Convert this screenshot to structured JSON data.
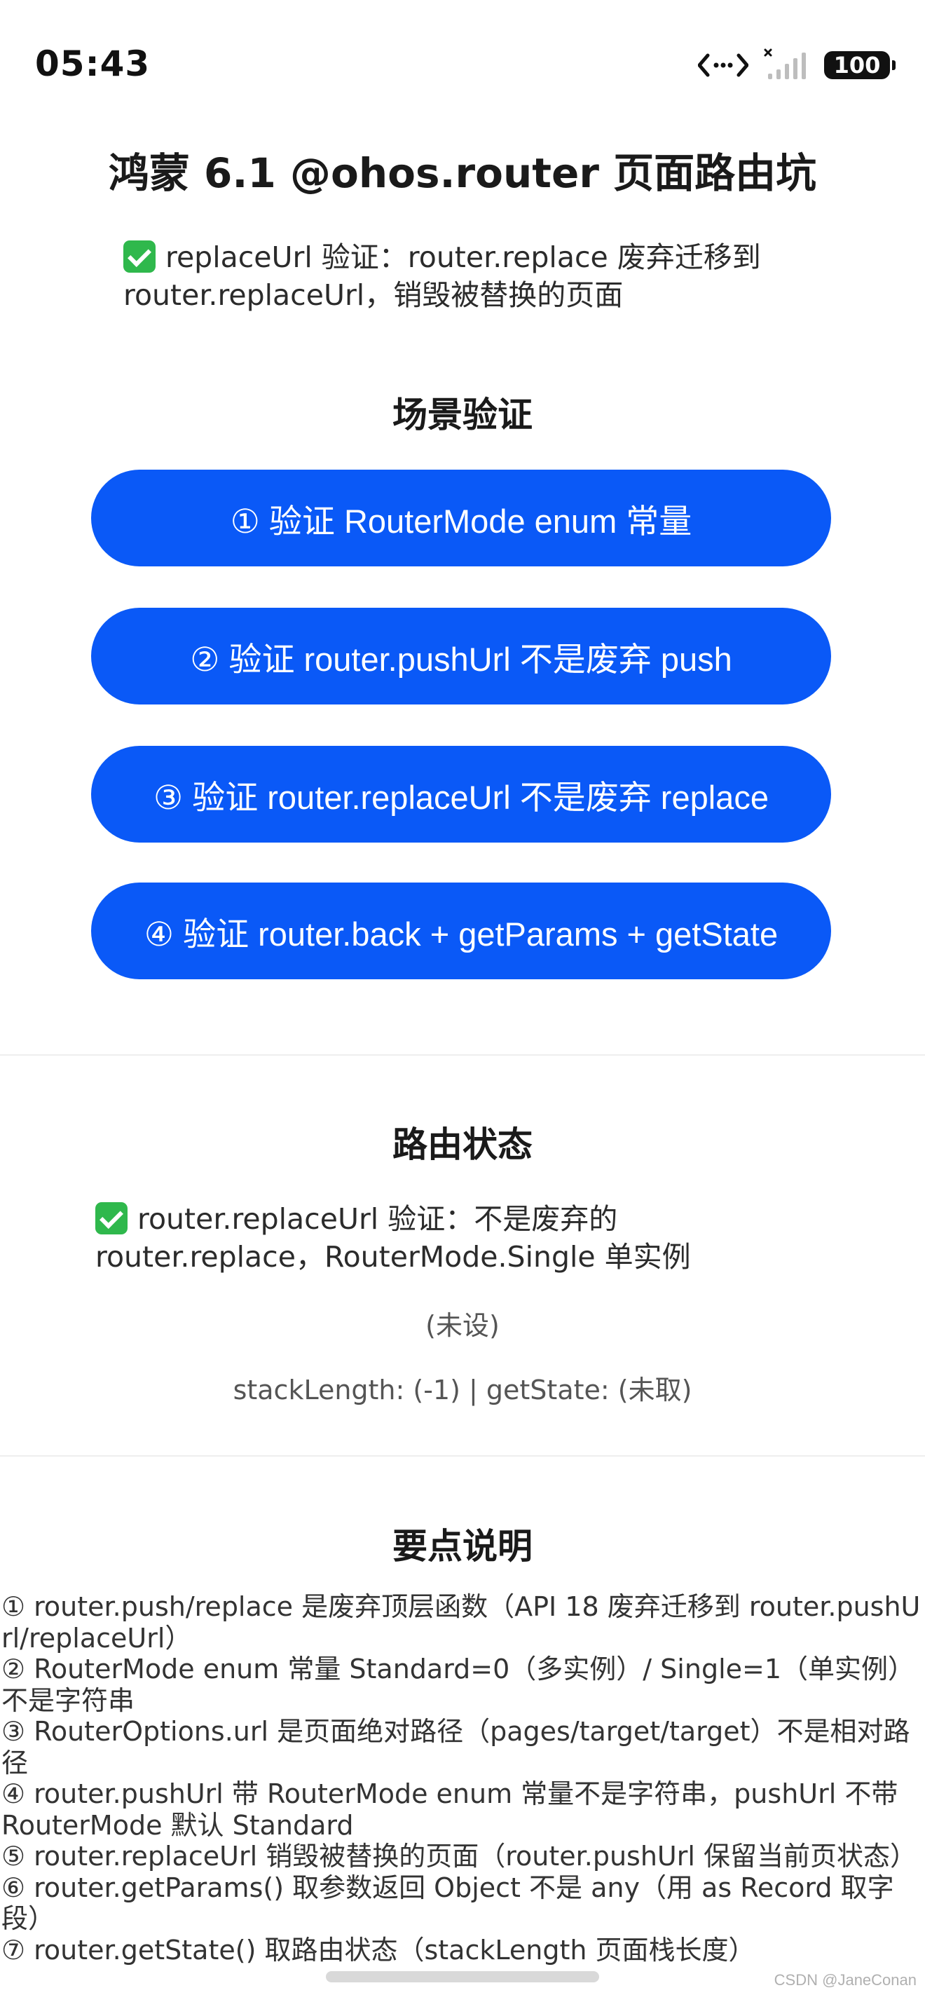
{
  "status_bar": {
    "time": "05:43",
    "battery": "100",
    "icons": [
      "dots-exchange-icon",
      "signal-icon",
      "battery-icon"
    ]
  },
  "page": {
    "title": "鸿蒙 6.1 @ohos.router 页面路由坑",
    "top_status": "replaceUrl 验证：router.replace 废弃迁移到 router.replaceUrl，销毁被替换的页面"
  },
  "scenarios": {
    "title": "场景验证",
    "buttons": [
      "① 验证 RouterMode enum 常量",
      "② 验证 router.pushUrl 不是废弃 push",
      "③ 验证 router.replaceUrl 不是废弃 replace",
      "④ 验证 router.back + getParams + getState"
    ]
  },
  "route_state": {
    "title": "路由状态",
    "status": "router.replaceUrl 验证：不是废弃的 router.replace，RouterMode.Single 单实例",
    "params": "(未设)",
    "stack": "stackLength: (-1) | getState: (未取)"
  },
  "notes": {
    "title": "要点说明",
    "items": [
      "① router.push/replace 是废弃顶层函数（API 18 废弃迁移到 router.pushUrl/replaceUrl）",
      "② RouterMode enum 常量 Standard=0（多实例）/ Single=1（单实例）不是字符串",
      "③ RouterOptions.url 是页面绝对路径（pages/target/target）不是相对路径",
      "④ router.pushUrl 带 RouterMode enum 常量不是字符串，pushUrl 不带 RouterMode 默认 Standard",
      "⑤ router.replaceUrl 销毁被替换的页面（router.pushUrl 保留当前页状态）",
      "⑥ router.getParams() 取参数返回 Object 不是 any（用 as Record 取字段）",
      "⑦ router.getState() 取路由状态（stackLength 页面栈长度）"
    ]
  },
  "watermark": "CSDN @JaneConan",
  "colors": {
    "primary_button": "#0a59f7",
    "check": "#2fb84c",
    "text": "#1f1f1f"
  }
}
